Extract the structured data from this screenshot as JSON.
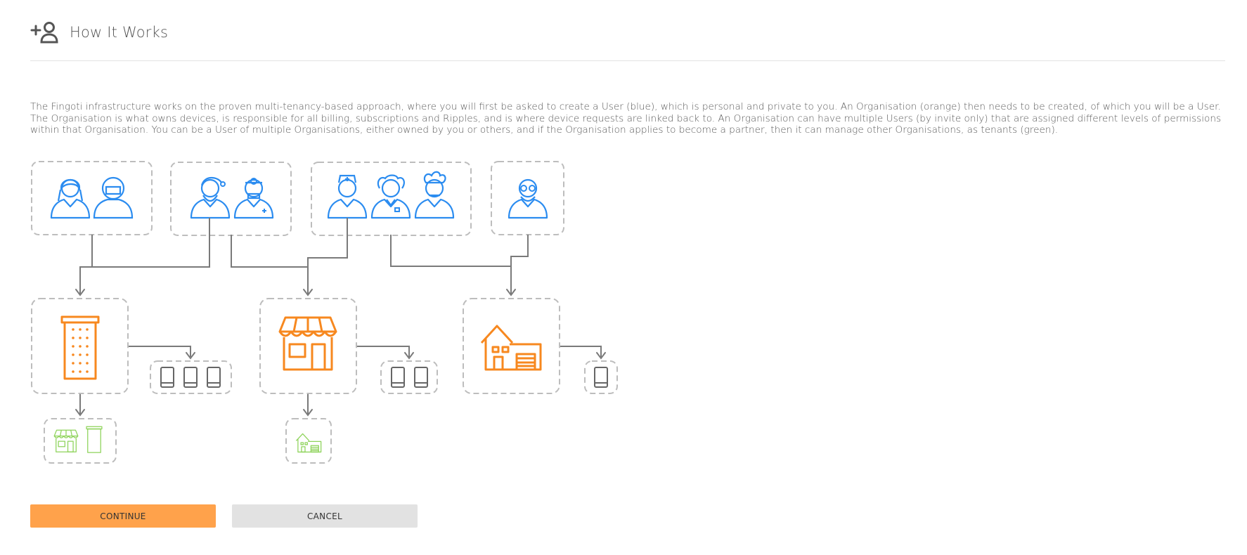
{
  "header": {
    "icon": "add-user-icon",
    "title": "How It Works"
  },
  "description": "The Fingoti infrastructure works on the proven multi-tenancy-based approach, where you will first be asked to create a User (blue), which is personal and private to you. An Organisation (orange) then needs to be created, of which you will be a User. The Organisation is what owns devices, is responsible for all billing, subscriptions and Ripples, and is where device requests are linked back to. An Organisation can have multiple Users (by invite only) that are assigned different levels of permissions within that Organisation. You can be a User of multiple Organisations, either owned by you or others, and if the Organisation applies to become a partner, then it can manage other Organisations, as tenants (green).",
  "colors": {
    "user": "#2b8cf0",
    "organisation": "#f7881f",
    "tenant": "#8ed35a",
    "connector": "#777777",
    "box_border": "#bbbbbb",
    "continue_button": "#ffa24b",
    "cancel_button": "#e2e2e2"
  },
  "diagram": {
    "user_groups": [
      {
        "icons": [
          "woman-avatar-icon",
          "astronaut-avatar-icon"
        ]
      },
      {
        "icons": [
          "santa-avatar-icon",
          "doctor-avatar-icon"
        ]
      },
      {
        "icons": [
          "nurse-avatar-icon",
          "scientist-avatar-icon",
          "chef-avatar-icon"
        ]
      },
      {
        "icons": [
          "old-man-glasses-avatar-icon"
        ]
      }
    ],
    "organisations": [
      {
        "icon": "office-building-icon",
        "device_count": 3,
        "tenant_icons": [
          "shop-icon",
          "office-building-icon"
        ]
      },
      {
        "icon": "shop-icon",
        "device_count": 2,
        "tenant_icons": [
          "house-icon"
        ]
      },
      {
        "icon": "house-icon",
        "device_count": 1,
        "tenant_icons": []
      }
    ]
  },
  "buttons": {
    "continue": "CONTINUE",
    "cancel": "CANCEL"
  }
}
